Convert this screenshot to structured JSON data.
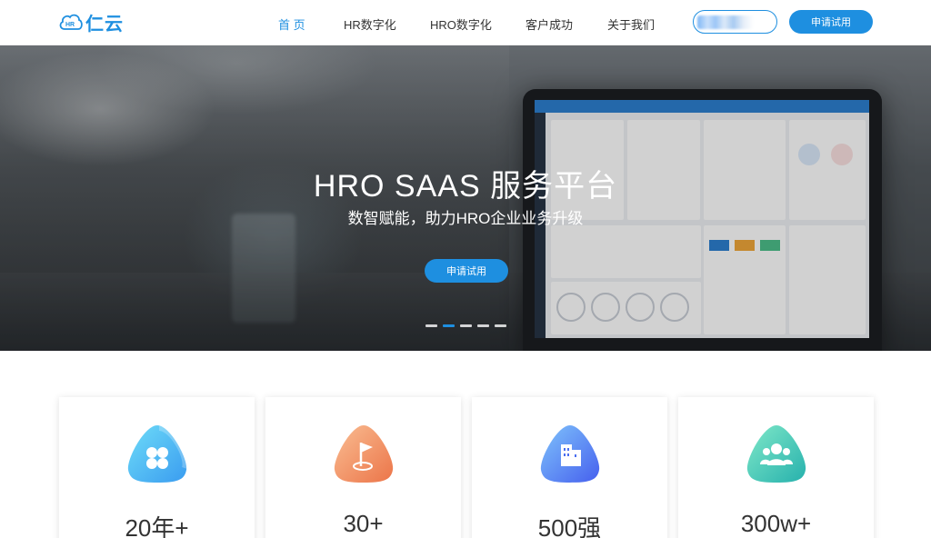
{
  "header": {
    "logo": {
      "mark": "HR",
      "name": "仁云"
    },
    "nav": [
      {
        "label": "首 页",
        "active": true
      },
      {
        "label": "HR数字化",
        "active": false
      },
      {
        "label": "HRO数字化",
        "active": false
      },
      {
        "label": "客户成功",
        "active": false
      },
      {
        "label": "关于我们",
        "active": false
      }
    ],
    "apply_label": "申请试用"
  },
  "hero": {
    "title": "HRO SAAS 服务平台",
    "subtitle": "数智赋能，助力HRO企业业务升级",
    "button_label": "申请试用",
    "slides_count": 5,
    "active_slide": 2
  },
  "stats": [
    {
      "value": "20年+",
      "icon": "clover-icon",
      "color_from": "#5fd0f5",
      "color_to": "#3aa2f0"
    },
    {
      "value": "30+",
      "icon": "flag-icon",
      "color_from": "#f8b38a",
      "color_to": "#ef7d52"
    },
    {
      "value": "500强",
      "icon": "building-icon",
      "color_from": "#7ab6fb",
      "color_to": "#4a6ef0"
    },
    {
      "value": "300w+",
      "icon": "people-icon",
      "color_from": "#6fe3c7",
      "color_to": "#2fb8b0"
    }
  ],
  "colors": {
    "accent": "#1e8fe0"
  }
}
